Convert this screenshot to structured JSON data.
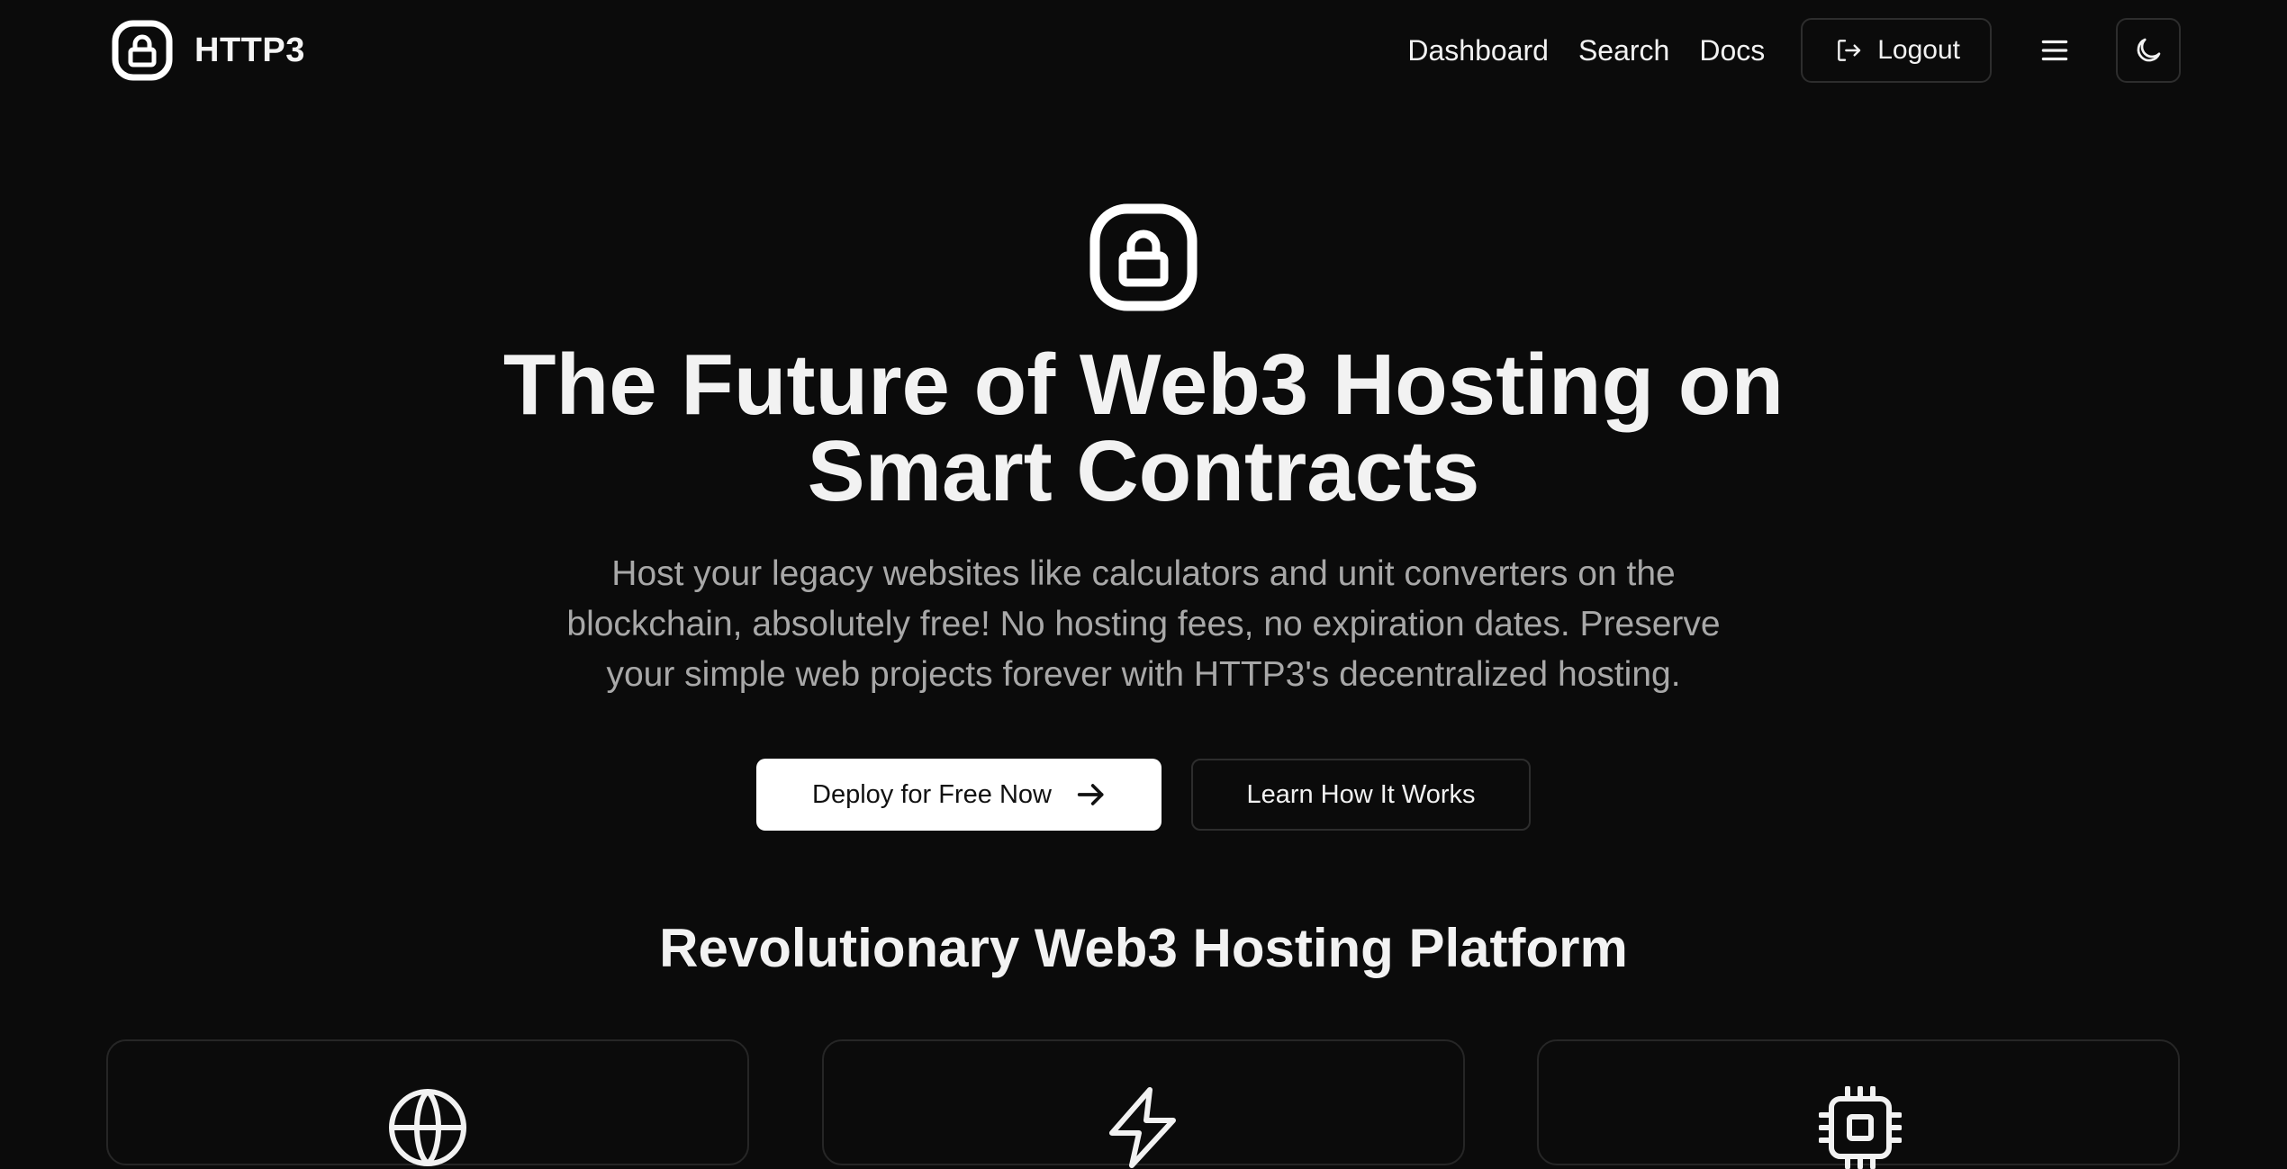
{
  "brand": {
    "name": "HTTP3",
    "logo_icon": "lock-icon"
  },
  "nav": {
    "links": [
      "Dashboard",
      "Search",
      "Docs"
    ],
    "logout_label": "Logout",
    "logout_icon": "logout-icon",
    "menu_icon": "hamburger-menu-icon",
    "theme_icon": "moon-icon"
  },
  "hero": {
    "icon": "lock-icon",
    "title_line1": "The Future of Web3 Hosting on",
    "title_line2": "Smart Contracts",
    "subtitle_line1": "Host your legacy websites like calculators and unit converters on the",
    "subtitle_line2": "blockchain, absolutely free! No hosting fees, no expiration dates. Preserve",
    "subtitle_line3": "your simple web projects forever with HTTP3's decentralized hosting.",
    "primary_cta": "Deploy for Free Now",
    "secondary_cta": "Learn How It Works"
  },
  "features": {
    "title": "Revolutionary Web3 Hosting Platform",
    "cards": [
      {
        "icon": "globe-icon"
      },
      {
        "icon": "zap-icon"
      },
      {
        "icon": "cpu-icon"
      }
    ]
  },
  "colors": {
    "background": "#0b0b0b",
    "text": "#f2f2f2",
    "muted": "#a8a8a8",
    "border": "#2d2d2d",
    "primary_button": "#ffffff"
  }
}
